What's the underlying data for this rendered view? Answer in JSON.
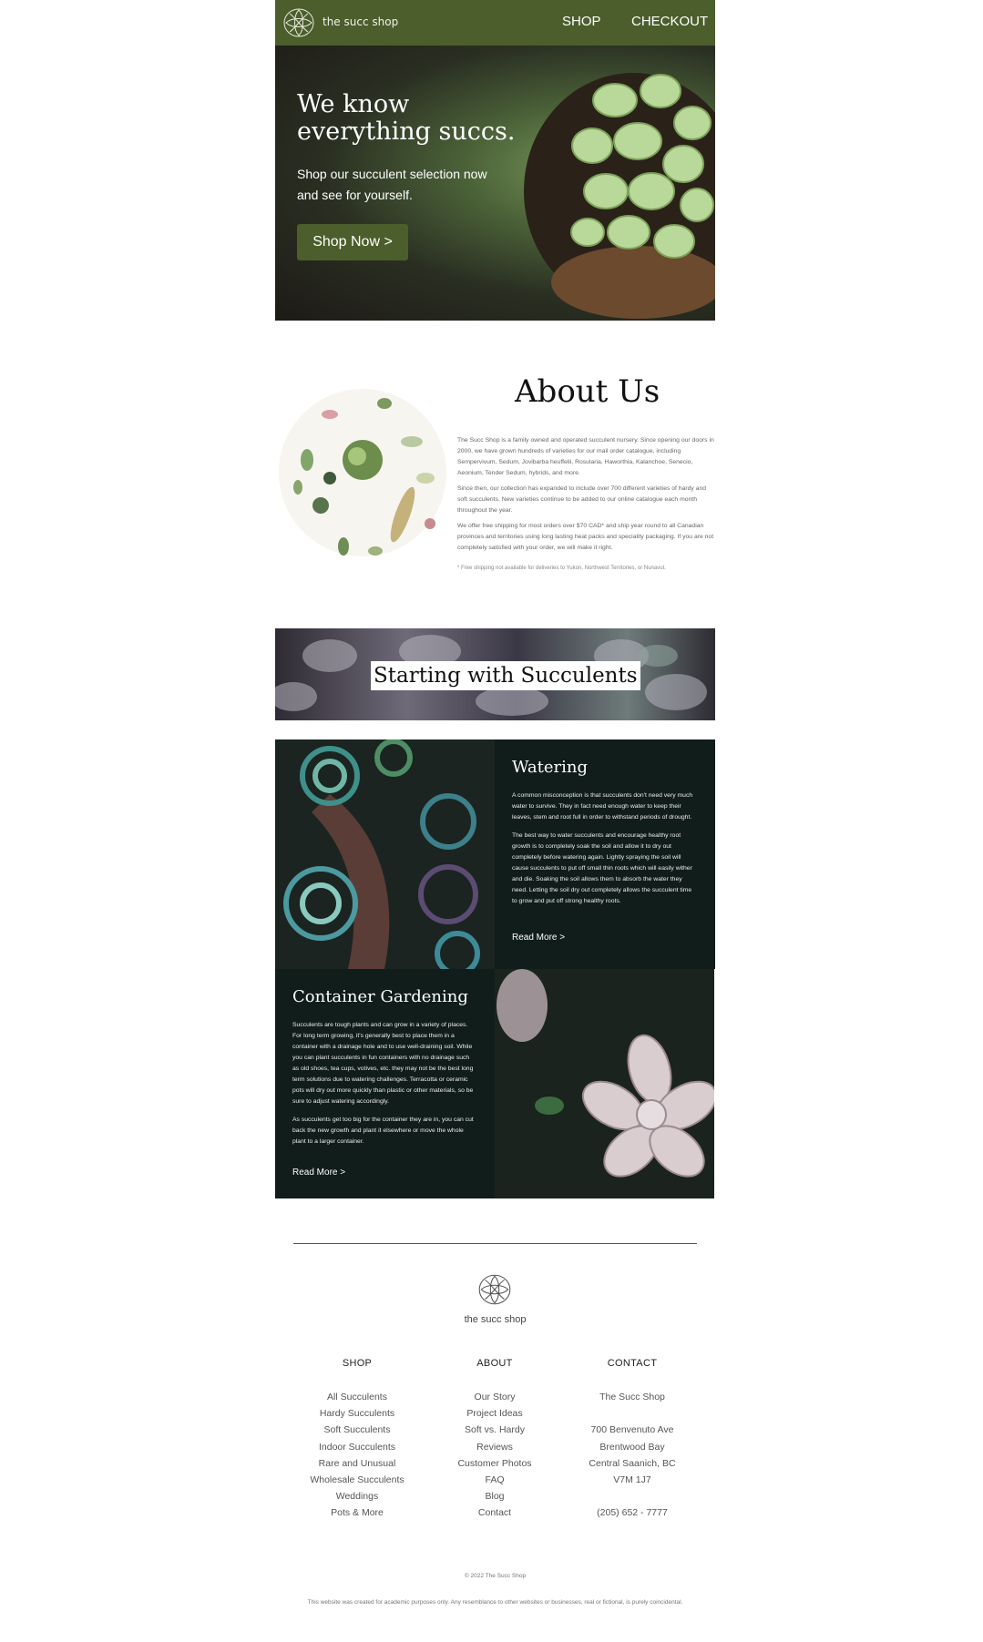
{
  "header": {
    "brand": "the succ shop",
    "nav": [
      "SHOP",
      "CHECKOUT"
    ]
  },
  "hero": {
    "title": "We know everything succs.",
    "subtitle": "Shop our succulent selection now and see for yourself.",
    "button": "Shop Now >"
  },
  "about": {
    "title": "About Us",
    "paragraphs": [
      "The Succ Shop is a family owned and operated succulent nursery. Since opening our doors in 2000, we have grown hundreds of varieties for our mail order catalogue, including Sempervivum, Sedum, Jovibarba heuffelii, Rosularia, Haworthia, Kalanchoe, Senecio, Aeonium, Tender Sedum, hybrids, and more.",
      "Since then, our collection has expanded to include over 700 different varieties of hardy and soft succulents. New varieties continue to be added to our online catalogue each month throughout the year.",
      "We offer free shipping for most orders over $70 CAD* and ship year round to all Canadian provinces and territories using long lasting heat packs and speciality packaging. If you are not completely satisfied with your order, we will make it right."
    ],
    "note": "* Free shipping not available for deliveries to Yukon, Northwest Territories, or Nunavut."
  },
  "banner": {
    "title": "Starting with Succulents"
  },
  "watering": {
    "title": "Watering",
    "paragraphs": [
      "A common misconception is that succulents don't need very much water to survive. They in fact need enough water to keep their leaves, stem and root full in order to withstand periods of drought.",
      "The best way to water succulents and encourage healthy root growth is to completely soak the soil and allow it to dry out completely before watering again. Lightly spraying the soil will cause succulents to put off small thin roots which will easily wither and die. Soaking the soil allows them to absorb the water they need. Letting the soil dry out completely allows the succulent time to grow and put off strong healthy roots."
    ],
    "more": "Read More >"
  },
  "container": {
    "title": "Container Gardening",
    "paragraphs": [
      "Succulents are tough plants and can grow in a variety of places. For long term growing, it's generally best to place them in a container with a drainage hole and to use well-draining soil. While you can plant succulents in fun containers with no drainage such as old shoes, tea cups, votives, etc. they may not be the best long term solutions due to watering challenges. Terracotta or ceramic pots will dry out more quickly than plastic or other materials, so be sure to adjust watering accordingly.",
      "As succulents get too big for the container they are in, you can cut back the new growth and plant it elsewhere or move the whole plant to a larger container."
    ],
    "more": "Read More >"
  },
  "footer": {
    "brand": "the succ shop",
    "shop": {
      "heading": "SHOP",
      "items": [
        "All Succulents",
        "Hardy Succulents",
        "Soft Succulents",
        "Indoor Succulents",
        "Rare and Unusual",
        "Wholesale Succulents",
        "Weddings",
        "Pots & More"
      ]
    },
    "about": {
      "heading": "ABOUT",
      "items": [
        "Our Story",
        "Project Ideas",
        "Soft vs. Hardy",
        "Reviews",
        "Customer Photos",
        "FAQ",
        "Blog",
        "Contact"
      ]
    },
    "contact": {
      "heading": "CONTACT",
      "name": "The Succ Shop",
      "address": [
        "700 Benvenuto Ave",
        "Brentwood Bay",
        "Central Saanich, BC",
        "V7M 1J7"
      ],
      "phone": "(205) 652 - 7777"
    },
    "copyright": "© 2022 The Succ Shop",
    "disclaimer": "This website was created for academic purposes only. Any resemblance to other websites or businesses, real or fictional, is purely coincidental."
  },
  "colors": {
    "brand_green": "#4b5e2b",
    "dark_tile": "#101d1b"
  }
}
